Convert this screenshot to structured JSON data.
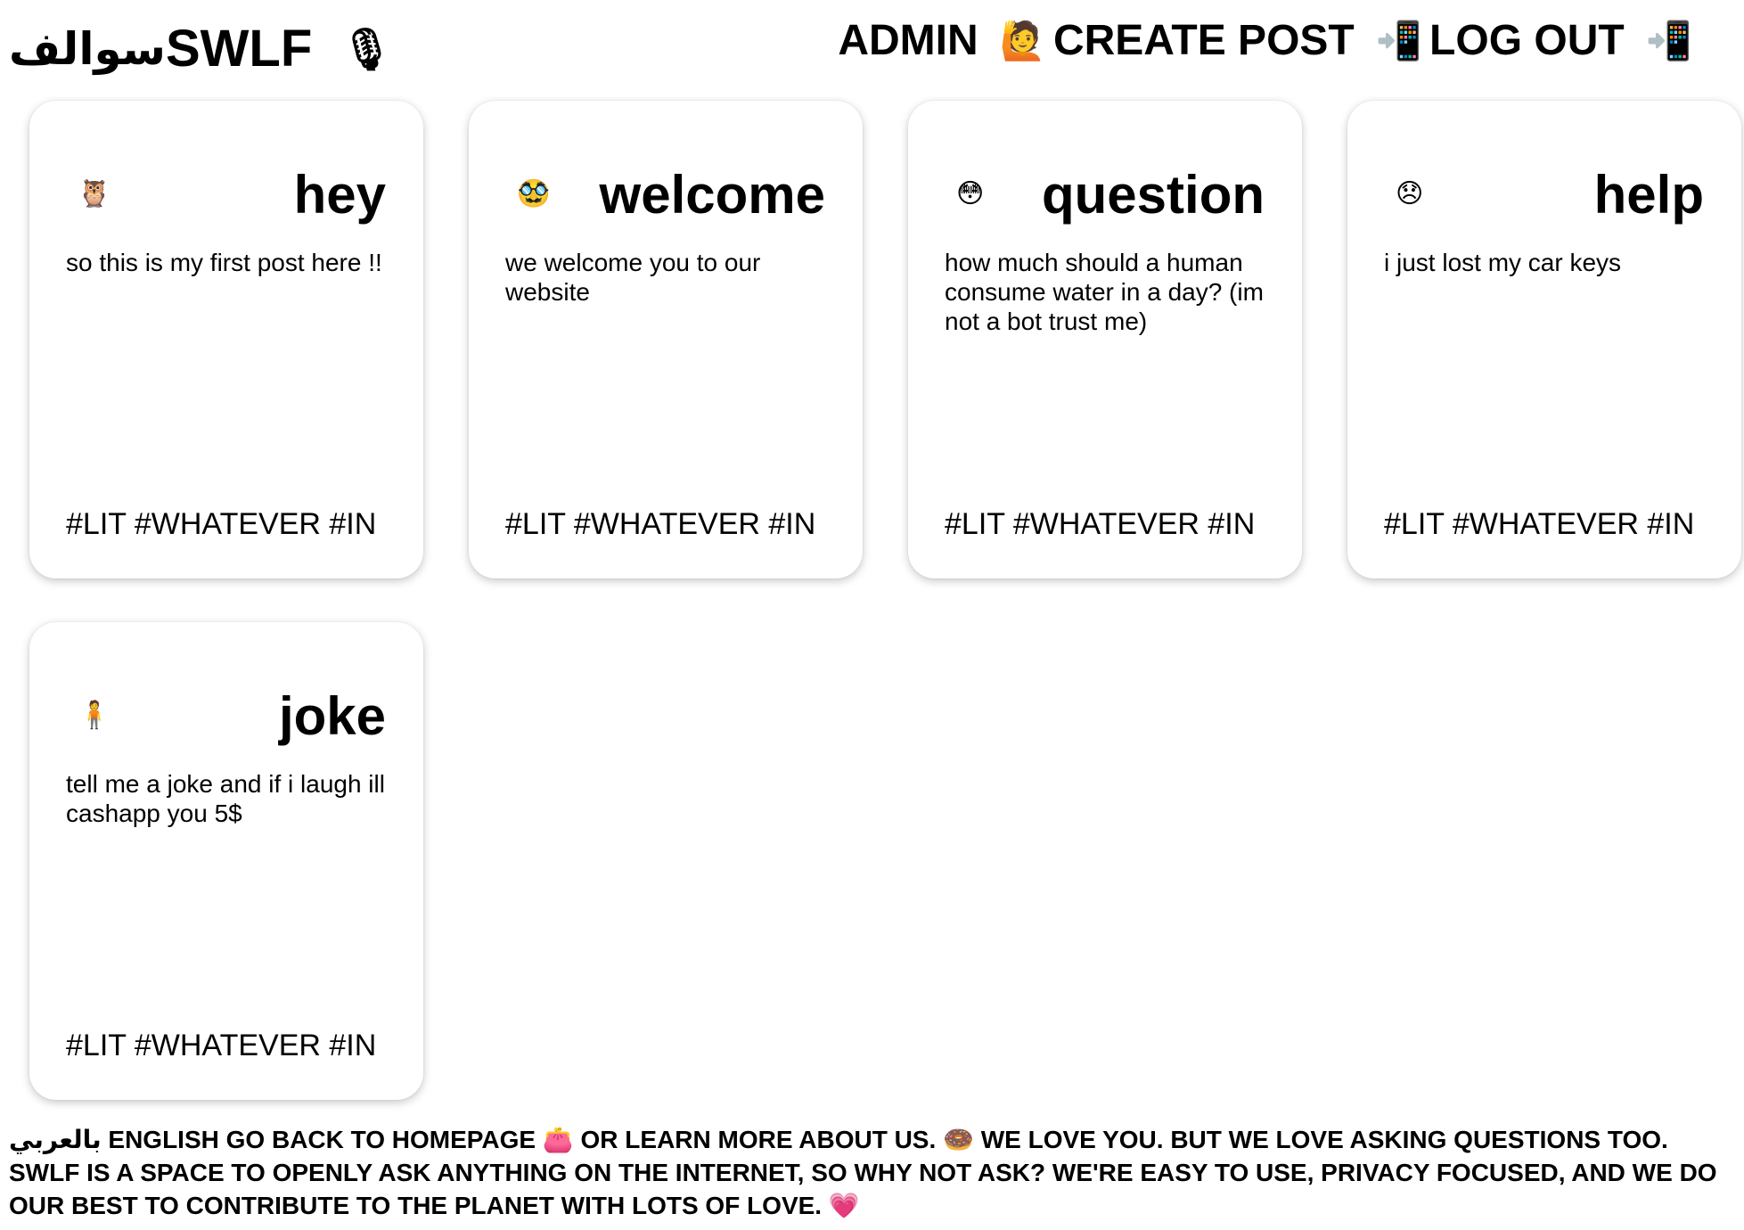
{
  "header": {
    "brand_arabic": "سوالف",
    "brand_latin": "SWLF",
    "brand_icon": "🎙",
    "nav": [
      {
        "label": "ADMIN",
        "icon": "🙋"
      },
      {
        "label": "CREATE POST",
        "icon": "📲"
      },
      {
        "label": "LOG OUT",
        "icon": "📲"
      }
    ]
  },
  "posts": [
    {
      "emoji": "🦉",
      "title": "hey",
      "body": "so this is my first post here !!",
      "tags": "#LIT #WHATEVER #IN"
    },
    {
      "emoji": "🥸",
      "title": "welcome",
      "body": "we welcome you to our website",
      "tags": "#LIT #WHATEVER #IN"
    },
    {
      "emoji": "😳",
      "title": "question",
      "body": "how much should a human consume water in a day? (im not a bot trust me)",
      "tags": "#LIT #WHATEVER #IN"
    },
    {
      "emoji": "😞",
      "title": "help",
      "body": "i just lost my car keys",
      "tags": "#LIT #WHATEVER #IN"
    },
    {
      "emoji": "🧍",
      "title": "joke",
      "body": "tell me a joke and if i laugh ill cashapp you 5$",
      "tags": "#LIT #WHATEVER #IN"
    }
  ],
  "footer": {
    "arabic_link": "بالعربي",
    "english_link": "ENGLISH",
    "homepage_text": "GO BACK TO HOMEPAGE",
    "homepage_icon": "👛",
    "about_text": "OR LEARN MORE ABOUT US.",
    "about_icon": "🍩",
    "tagline": "WE LOVE YOU. BUT WE LOVE ASKING QUESTIONS TOO. SWLF IS A SPACE TO OPENLY ASK ANYTHING ON THE INTERNET, SO WHY NOT ASK? WE'RE EASY TO USE, PRIVACY FOCUSED, AND WE DO OUR BEST TO CONTRIBUTE TO THE PLANET WITH LOTS OF LOVE.",
    "tagline_icon": "💗"
  }
}
